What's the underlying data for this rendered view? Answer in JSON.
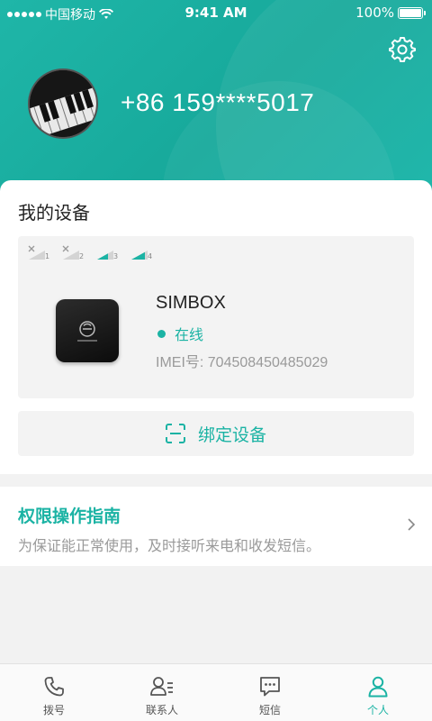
{
  "status_bar": {
    "carrier": "中国移动",
    "time": "9:41 AM",
    "battery": "100%"
  },
  "profile": {
    "phone_number": "+86 159****5017"
  },
  "device_section": {
    "title": "我的设备",
    "signal_slots": [
      "1",
      "2",
      "3",
      "4"
    ],
    "device": {
      "name": "SIMBOX",
      "status": "在线",
      "imei": "IMEI号: 704508450485029"
    },
    "bind_label": "绑定设备"
  },
  "guide": {
    "title": "权限操作指南",
    "subtitle": "为保证能正常使用，及时接听来电和收发短信。"
  },
  "tabbar": {
    "tabs": [
      {
        "label": "拨号",
        "icon": "phone-icon"
      },
      {
        "label": "联系人",
        "icon": "contacts-icon"
      },
      {
        "label": "短信",
        "icon": "message-icon"
      },
      {
        "label": "个人",
        "icon": "person-icon"
      }
    ],
    "active_index": 3
  },
  "colors": {
    "accent": "#1bb3a4",
    "header": "#17a99b"
  }
}
